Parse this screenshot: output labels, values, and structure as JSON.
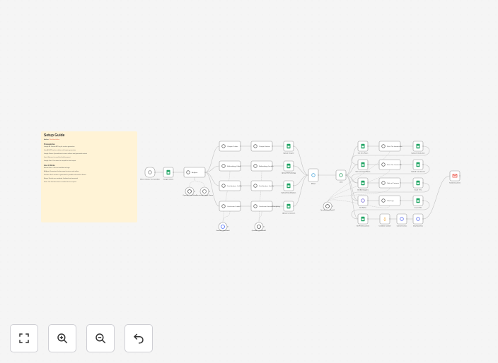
{
  "sticky": {
    "title": "Setup Guide",
    "author_prefix": "Author:",
    "author": "Workflow Author",
    "section1": "Prerequisites",
    "lines1": [
      "Google AI: Gemini API key for section generation",
      "OpenAI: API key for outline and chapter generation",
      "Google Sheets: Spreadsheet to store outlines and generated content",
      "Gmail: Account to send the final document",
      "Google Docs: Document to compile the final output"
    ],
    "section2": "How it Works",
    "lines2": [
      "Manual Start: Click test workflow to begin",
      "AI Agent: Generates the document structure and outline",
      "Sections: Each section is generated in parallel and saved to Sheets",
      "Merge: Results are combined, finalized and converted",
      "Send: The final document is emailed to the recipient"
    ]
  },
  "nodes": [
    {
      "label": "When clicking 'Test workflow'",
      "icon": "cursor-icon"
    },
    {
      "label": "Google Sheets",
      "icon": "sheets-icon"
    },
    {
      "label": "AI Agent",
      "icon": "robot-icon"
    },
    {
      "label": "OpenAI Chat Model",
      "icon": "openai-icon"
    },
    {
      "label": "Structured Output Parser",
      "icon": "parser-icon"
    },
    {
      "label": "Chapter Outline",
      "icon": "robot-icon"
    },
    {
      "label": "Methodology Outline",
      "icon": "robot-icon"
    },
    {
      "label": "Data Analysis Outline",
      "icon": "robot-icon"
    },
    {
      "label": "Conclusion Outline",
      "icon": "robot-icon"
    },
    {
      "label": "Chapter Section",
      "icon": "robot-icon"
    },
    {
      "label": "Methodology Section",
      "icon": "robot-icon"
    },
    {
      "label": "Data Analysis Section",
      "icon": "robot-icon"
    },
    {
      "label": "Conclusion Section Everything",
      "icon": "robot-icon"
    },
    {
      "label": "Upload Chapter",
      "icon": "sheets-icon"
    },
    {
      "label": "Upload Methodology",
      "icon": "sheets-icon"
    },
    {
      "label": "Upload Data Analysis",
      "icon": "sheets-icon"
    },
    {
      "label": "Upload Conclusion",
      "icon": "sheets-icon"
    },
    {
      "label": "Gemini Chat Model",
      "icon": "gemini-icon"
    },
    {
      "label": "OpenAI Chat Model1",
      "icon": "openai-icon"
    },
    {
      "label": "Merge",
      "icon": "merge-icon"
    },
    {
      "label": "Limit",
      "icon": "limit-icon"
    },
    {
      "label": "Get Intro Rows",
      "icon": "sheets-icon"
    },
    {
      "label": "Write The Introduction",
      "icon": "robot-icon"
    },
    {
      "label": "Upload Introduction",
      "icon": "sheets-icon"
    },
    {
      "label": "Get Conclusion Rows",
      "icon": "sheets-icon"
    },
    {
      "label": "Write The Conclusion",
      "icon": "robot-icon"
    },
    {
      "label": "Upload Conclusion1",
      "icon": "sheets-icon"
    },
    {
      "label": "Get All Chapters",
      "icon": "sheets-icon"
    },
    {
      "label": "Table of Contents",
      "icon": "robot-icon"
    },
    {
      "label": "Insert TOC",
      "icon": "sheets-icon"
    },
    {
      "label": "Set Name",
      "icon": "pencil-icon"
    },
    {
      "label": "Title Page",
      "icon": "robot-icon"
    },
    {
      "label": "Insert Title",
      "icon": "sheets-icon"
    },
    {
      "label": "Get Full Document",
      "icon": "sheets-icon"
    },
    {
      "label": "Combine Content",
      "icon": "code-icon"
    },
    {
      "label": "Convert to Doc",
      "icon": "http-icon"
    },
    {
      "label": "Download Doc",
      "icon": "http-icon"
    },
    {
      "label": "OpenAI Chat Model2",
      "icon": "openai-icon"
    },
    {
      "label": "Send Document",
      "icon": "gmail-icon"
    }
  ],
  "controls": {
    "fit": "fit-view-icon",
    "zoom_in": "zoom-in-icon",
    "zoom_out": "zoom-out-icon",
    "undo": "undo-icon"
  },
  "colors": {
    "sheets": "#1fa463",
    "sticky": "#fff3d6",
    "gemini": "#4a6cf7",
    "code": "#f0a22e",
    "http": "#5b6ef0",
    "gmail": "#ea4335"
  }
}
